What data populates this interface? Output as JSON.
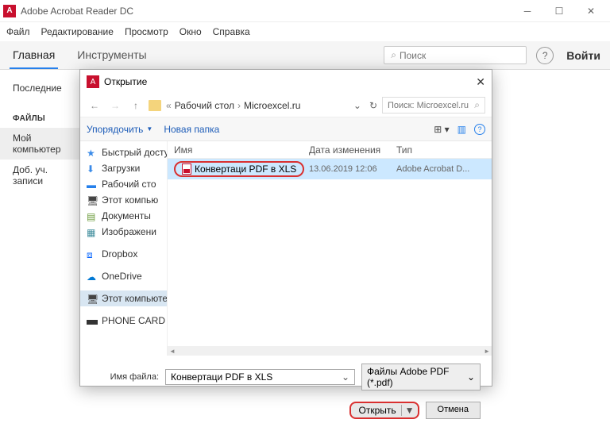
{
  "app": {
    "title": "Adobe Acrobat Reader DC"
  },
  "menu": {
    "file": "Файл",
    "edit": "Редактирование",
    "view": "Просмотр",
    "window": "Окно",
    "help": "Справка"
  },
  "tabs": {
    "home": "Главная",
    "tools": "Инструменты"
  },
  "search": {
    "placeholder": "Поиск"
  },
  "signin": "Войти",
  "side": {
    "recent": "Последние",
    "files": "ФАЙЛЫ",
    "mypc": "Мой компьютер",
    "addacct": "Доб. уч. записи"
  },
  "dlg": {
    "title": "Открытие",
    "crumb1": "Рабочий стол",
    "crumb2": "Microexcel.ru",
    "searchph": "Поиск: Microexcel.ru",
    "organize": "Упорядочить",
    "newfolder": "Новая папка",
    "col_name": "Имя",
    "col_date": "Дата изменения",
    "col_type": "Тип",
    "file_name": "Конвертаци PDF в XLS",
    "file_date": "13.06.2019 12:06",
    "file_type": "Adobe Acrobat D...",
    "nav": {
      "quick": "Быстрый доступ",
      "downloads": "Загрузки",
      "desktop": "Рабочий сто",
      "thispc2": "Этот компью",
      "docs": "Документы",
      "images": "Изображени",
      "dropbox": "Dropbox",
      "onedrive": "OneDrive",
      "thispc": "Этот компьютер",
      "phone": "PHONE CARD (E:)"
    },
    "fname_lbl": "Имя файла:",
    "fname_val": "Конвертаци PDF в XLS",
    "filter": "Файлы Adobe PDF (*.pdf)",
    "open": "Открыть",
    "cancel": "Отмена"
  }
}
